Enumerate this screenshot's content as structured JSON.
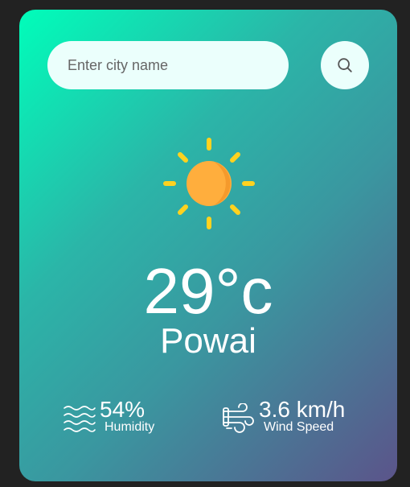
{
  "search": {
    "placeholder": "Enter city name",
    "value": ""
  },
  "weather": {
    "icon": "sun-icon",
    "temperature": "29°c",
    "city": "Powai"
  },
  "details": {
    "humidity_value": "54%",
    "humidity_label": "Humidity",
    "wind_value": "3.6 km/h",
    "wind_label": "Wind Speed"
  },
  "colors": {
    "gradient_start": "#00feba",
    "gradient_end": "#5b548a",
    "input_bg": "#ebfffc",
    "sun_core": "#ffae3d",
    "sun_rays": "#ffd21f"
  }
}
